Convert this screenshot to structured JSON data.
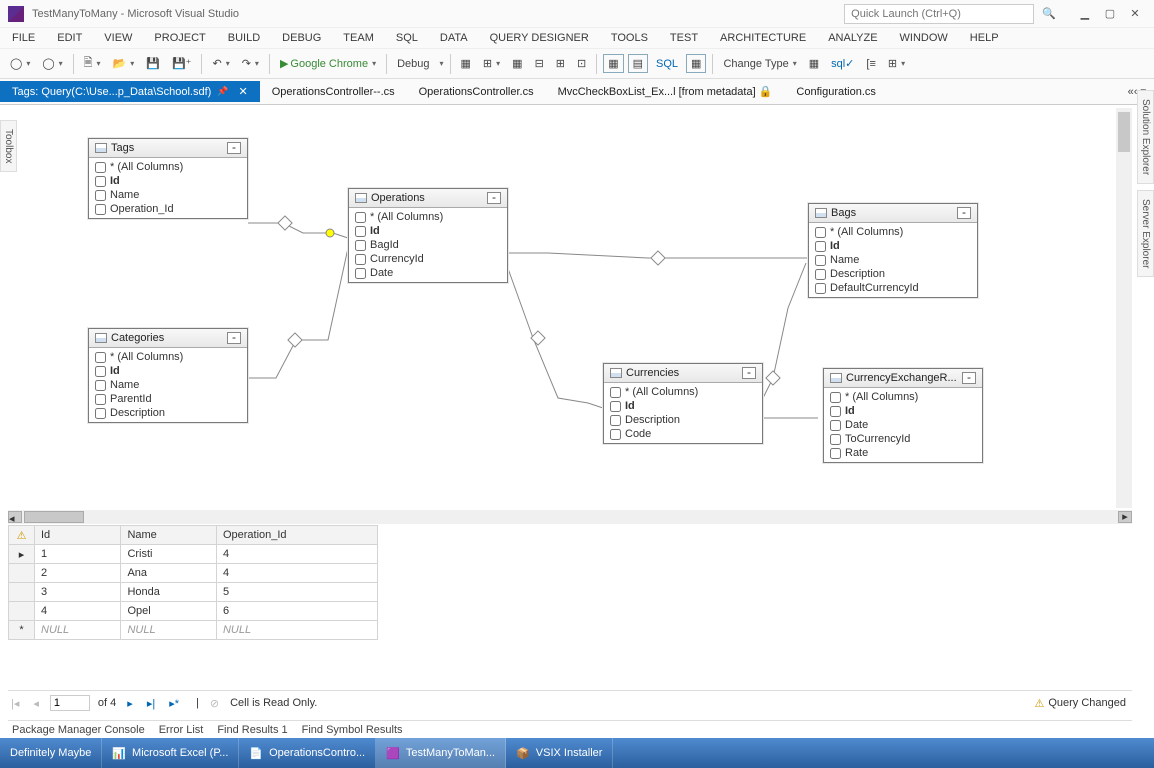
{
  "title": "TestManyToMany - Microsoft Visual Studio",
  "quick_launch_placeholder": "Quick Launch (Ctrl+Q)",
  "menu": [
    "FILE",
    "EDIT",
    "VIEW",
    "PROJECT",
    "BUILD",
    "DEBUG",
    "TEAM",
    "SQL",
    "DATA",
    "QUERY DESIGNER",
    "TOOLS",
    "TEST",
    "ARCHITECTURE",
    "ANALYZE",
    "WINDOW",
    "HELP"
  ],
  "toolbar": {
    "browser": "Google Chrome",
    "config": "Debug",
    "changetype": "Change Type"
  },
  "tabs": {
    "active": "Tags: Query(C:\\Use...p_Data\\School.sdf)",
    "others": [
      "OperationsController--.cs",
      "OperationsController.cs",
      "MvcCheckBoxList_Ex...l [from metadata]",
      "Configuration.cs"
    ]
  },
  "side": {
    "left": "Toolbox",
    "right1": "Solution Explorer",
    "right2": "Server Explorer"
  },
  "tables": {
    "tags": {
      "title": "Tags",
      "cols": [
        "* (All Columns)",
        "Id",
        "Name",
        "Operation_Id"
      ],
      "pk": 1
    },
    "operations": {
      "title": "Operations",
      "cols": [
        "* (All Columns)",
        "Id",
        "BagId",
        "CurrencyId",
        "Date"
      ],
      "pk": 1
    },
    "categories": {
      "title": "Categories",
      "cols": [
        "* (All Columns)",
        "Id",
        "Name",
        "ParentId",
        "Description"
      ],
      "pk": 1
    },
    "bags": {
      "title": "Bags",
      "cols": [
        "* (All Columns)",
        "Id",
        "Name",
        "Description",
        "DefaultCurrencyId"
      ],
      "pk": 1
    },
    "currencies": {
      "title": "Currencies",
      "cols": [
        "* (All Columns)",
        "Id",
        "Description",
        "Code"
      ],
      "pk": 1
    },
    "cer": {
      "title": "CurrencyExchangeR...",
      "cols": [
        "* (All Columns)",
        "Id",
        "Date",
        "ToCurrencyId",
        "Rate"
      ],
      "pk": 1
    }
  },
  "grid": {
    "headers": [
      "Id",
      "Name",
      "Operation_Id"
    ],
    "rows": [
      {
        "id": "1",
        "name": "Cristi",
        "op": "4"
      },
      {
        "id": "2",
        "name": "Ana",
        "op": "4"
      },
      {
        "id": "3",
        "name": "Honda",
        "op": "5"
      },
      {
        "id": "4",
        "name": "Opel",
        "op": "6"
      }
    ],
    "null": "NULL"
  },
  "nav": {
    "pos": "1",
    "total": "of 4",
    "readonly": "Cell is Read Only.",
    "changed": "Query Changed"
  },
  "bottom_tabs": [
    "Package Manager Console",
    "Error List",
    "Find Results 1",
    "Find Symbol Results"
  ],
  "taskbar": [
    "Definitely Maybe",
    "Microsoft Excel (P...",
    "OperationsContro...",
    "TestManyToMan...",
    "VSIX Installer"
  ]
}
